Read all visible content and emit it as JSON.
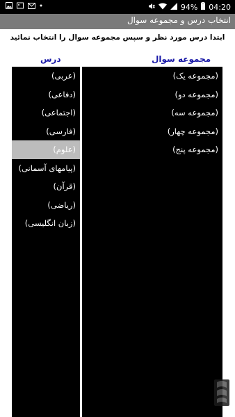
{
  "status_bar": {
    "time": "04:20",
    "battery": "94%",
    "icons": [
      "gallery-icon",
      "picture-icon",
      "mail-icon",
      "dots-icon",
      "mute-icon",
      "wifi-icon",
      "signal-icon",
      "battery-icon"
    ]
  },
  "header": {
    "title": "انتخاب درس و  مجموعه سوال"
  },
  "instruction": "ابتدا درس مورد نظر و سپس مجموعه سوال را انتخاب نمائید",
  "lessons_header": "درس",
  "sets_header": "مجموعه سوال",
  "lessons": [
    {
      "label": "(عربی)",
      "selected": false
    },
    {
      "label": "(دفاعی)",
      "selected": false
    },
    {
      "label": "(اجتماعی)",
      "selected": false
    },
    {
      "label": "(فارسی)",
      "selected": false
    },
    {
      "label": "(علوم)",
      "selected": true
    },
    {
      "label": "(پیامهای آسمانی)",
      "selected": false
    },
    {
      "label": "(قرآن)",
      "selected": false
    },
    {
      "label": "(ریاضی)",
      "selected": false
    },
    {
      "label": "(زبان انگلیسی)",
      "selected": false
    }
  ],
  "sets": [
    {
      "label": "(مجموعه یک)"
    },
    {
      "label": "(مجموعه دو)"
    },
    {
      "label": "(مجموعه  سه)"
    },
    {
      "label": "(مجموعه  چهار)"
    },
    {
      "label": "(مجموعه پنج)"
    }
  ],
  "colors": {
    "accent_header": "#1a1aa8",
    "title_bar": "#7a7a7a",
    "selected_row": "#bcbcbc"
  }
}
